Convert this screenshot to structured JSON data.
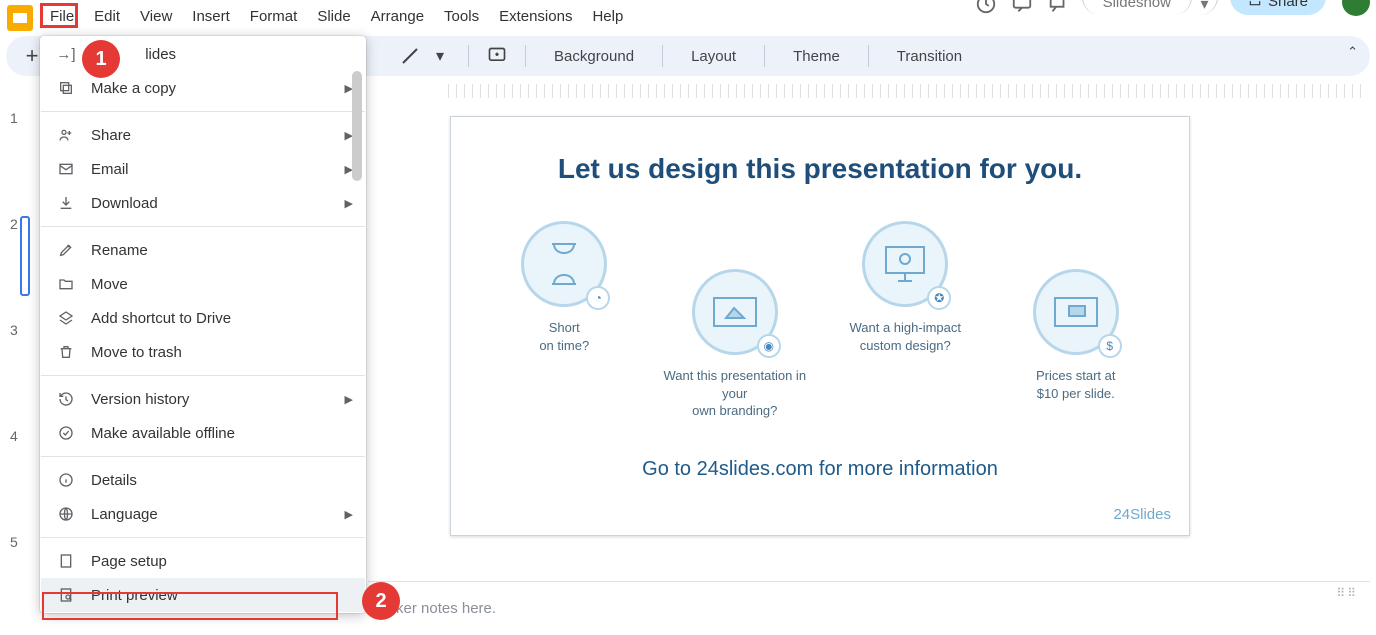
{
  "header": {
    "menus": [
      "File",
      "Edit",
      "View",
      "Insert",
      "Format",
      "Slide",
      "Arrange",
      "Tools",
      "Extensions",
      "Help"
    ],
    "slideshow_label": "Slideshow",
    "share_label": "Share"
  },
  "toolbar": {
    "background": "Background",
    "layout": "Layout",
    "theme": "Theme",
    "transition": "Transition"
  },
  "file_menu": {
    "import_label": "Import slides",
    "make_copy": "Make a copy",
    "share": "Share",
    "email": "Email",
    "download": "Download",
    "rename": "Rename",
    "move": "Move",
    "add_shortcut": "Add shortcut to Drive",
    "move_to_trash": "Move to trash",
    "version_history": "Version history",
    "make_available_offline": "Make available offline",
    "details": "Details",
    "language": "Language",
    "page_setup": "Page setup",
    "print_preview": "Print preview"
  },
  "annotations": {
    "badge1": "1",
    "badge2": "2"
  },
  "thumbnails": {
    "numbers": [
      "1",
      "2",
      "3",
      "4",
      "5"
    ]
  },
  "slide": {
    "title": "Let us design this presentation for you.",
    "cap1a": "Short",
    "cap1b": "on time?",
    "cap2a": "Want this presentation in your",
    "cap2b": "own branding?",
    "cap3a": "Want a high-impact",
    "cap3b": "custom design?",
    "cap4a": "Prices start at",
    "cap4b": "$10 per slide.",
    "more": "Go to 24slides.com for more information",
    "brand": "24Slides"
  },
  "notes": {
    "placeholder": "ker notes here."
  }
}
